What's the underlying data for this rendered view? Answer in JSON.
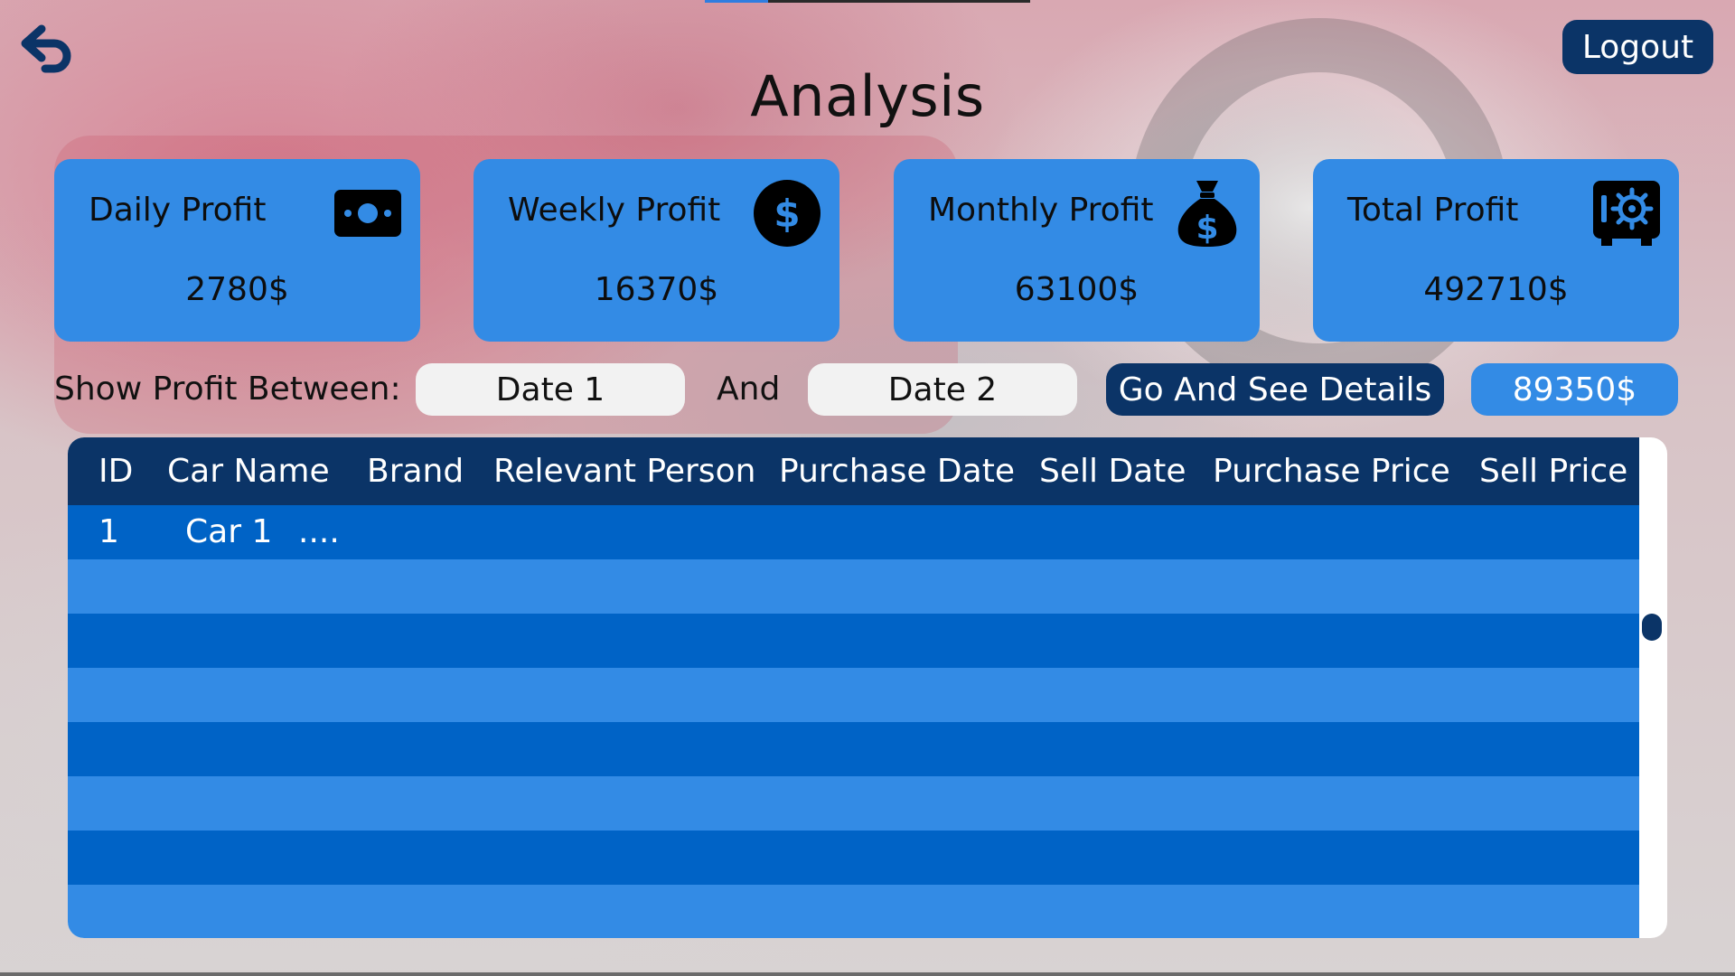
{
  "header": {
    "title": "Analysis",
    "logout_label": "Logout",
    "back_icon": "return-arrow-icon"
  },
  "cards": [
    {
      "label": "Daily Profit",
      "value": "2780$",
      "icon": "banknote-icon"
    },
    {
      "label": "Weekly Profit",
      "value": "16370$",
      "icon": "dollar-circle-icon"
    },
    {
      "label": "Monthly Profit",
      "value": "63100$",
      "icon": "money-bag-icon"
    },
    {
      "label": "Total Profit",
      "value": "492710$",
      "icon": "safe-icon"
    }
  ],
  "range": {
    "label": "Show Profit Between:",
    "date1": "Date 1",
    "and_label": "And",
    "date2": "Date 2",
    "go_label": "Go And See Details",
    "result": "89350$"
  },
  "table": {
    "columns": [
      "ID",
      "Car Name",
      "Brand",
      "Relevant Person",
      "Purchase Date",
      "Sell Date",
      "Purchase Price",
      "Sell Price"
    ],
    "rows": [
      [
        "1",
        "Car 1",
        "....",
        "",
        "",
        "",
        "",
        ""
      ],
      [
        "",
        "",
        "",
        "",
        "",
        "",
        "",
        ""
      ],
      [
        "",
        "",
        "",
        "",
        "",
        "",
        "",
        ""
      ],
      [
        "",
        "",
        "",
        "",
        "",
        "",
        "",
        ""
      ],
      [
        "",
        "",
        "",
        "",
        "",
        "",
        "",
        ""
      ],
      [
        "",
        "",
        "",
        "",
        "",
        "",
        "",
        ""
      ],
      [
        "",
        "",
        "",
        "",
        "",
        "",
        "",
        ""
      ],
      [
        "",
        "",
        "",
        "",
        "",
        "",
        "",
        ""
      ]
    ]
  },
  "colors": {
    "card_blue": "#338be5",
    "navy": "#0b3467",
    "row_dark": "#0063c6",
    "row_light": "#338be5"
  }
}
